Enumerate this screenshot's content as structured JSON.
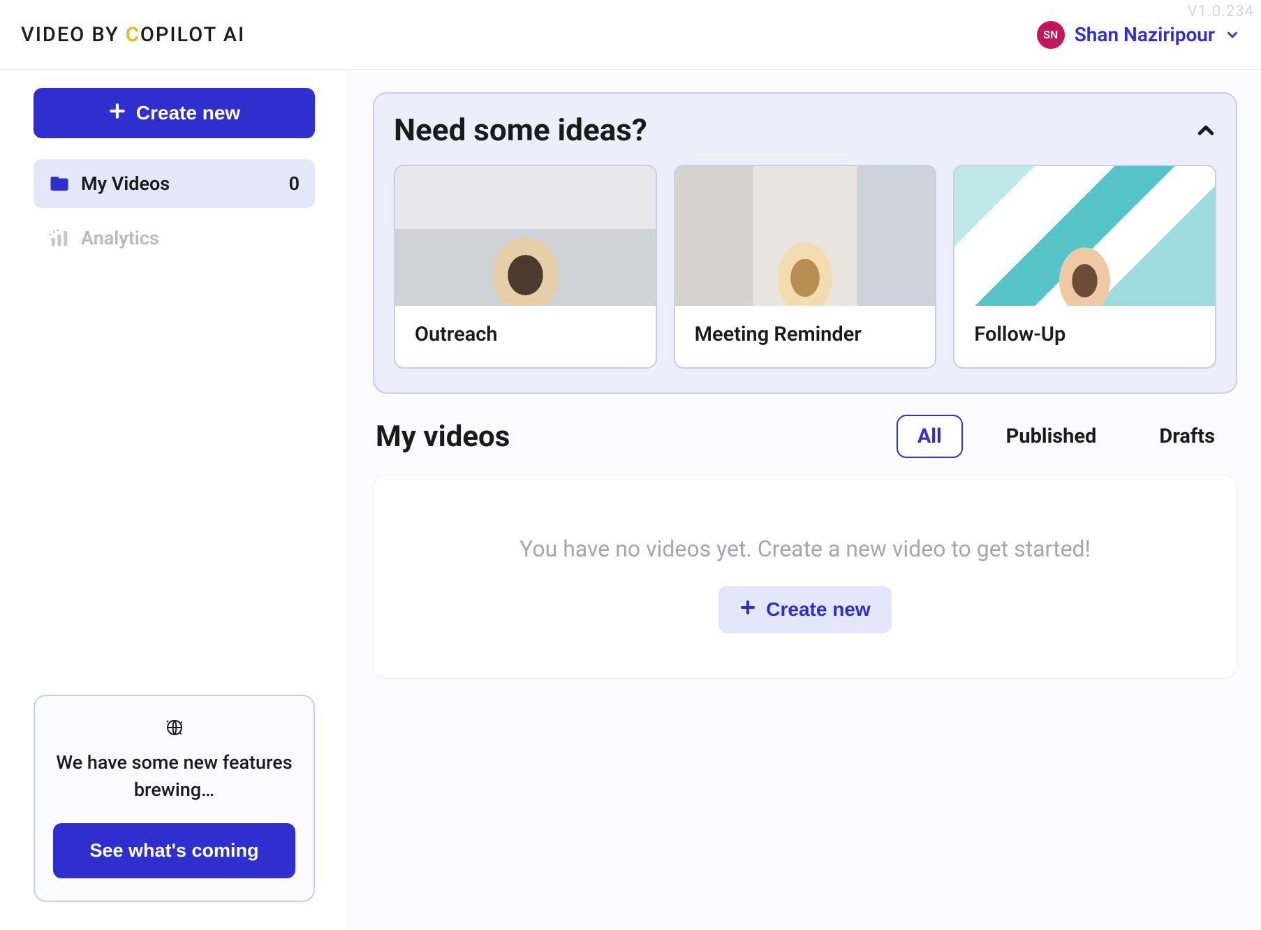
{
  "app": {
    "version": "V1.0.234",
    "logo_prefix": "VIDEO BY ",
    "logo_c": "C",
    "logo_suffix": "OPILOT AI"
  },
  "user": {
    "initials": "SN",
    "name": "Shan Naziripour"
  },
  "sidebar": {
    "create_label": "Create new",
    "items": [
      {
        "label": "My Videos",
        "count": "0",
        "icon": "folder-icon",
        "active": true
      },
      {
        "label": "Analytics",
        "icon": "analytics-icon",
        "disabled": true
      }
    ],
    "promo": {
      "text": "We have some new features brewing…",
      "cta": "See what's coming"
    }
  },
  "ideas": {
    "title": "Need some ideas?",
    "cards": [
      {
        "label": "Outreach"
      },
      {
        "label": "Meeting Reminder"
      },
      {
        "label": "Follow-Up"
      }
    ]
  },
  "videos": {
    "title": "My videos",
    "filters": {
      "all": "All",
      "published": "Published",
      "drafts": "Drafts"
    },
    "empty_text": "You have no videos yet. Create a new video to get started!",
    "empty_cta": "Create new"
  }
}
